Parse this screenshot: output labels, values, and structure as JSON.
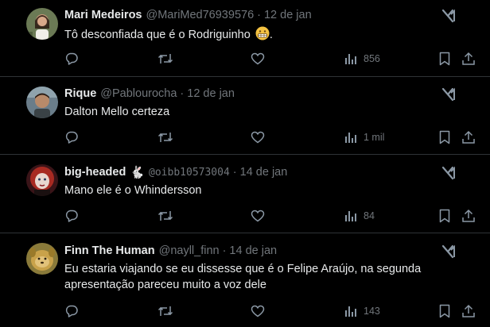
{
  "tweets": [
    {
      "name": "Mari Medeiros",
      "handle": "@MariMed76939576",
      "separator": "·",
      "date": "12 de jan",
      "text": "Tô desconfiada que é o Rodriguinho",
      "text_suffix": ".",
      "emoji": "grimacing-face-emoji",
      "views": "856"
    },
    {
      "name": "Rique",
      "handle": "@Pablourocha",
      "separator": "·",
      "date": "12 de jan",
      "text": "Dalton Mello certeza",
      "views": "1 mil"
    },
    {
      "name": "big-headed",
      "name_badge": "🐇",
      "handle": "@oibb10573004",
      "separator": "·",
      "date": "14 de jan",
      "text": "Mano ele é o Whindersson",
      "views": "84"
    },
    {
      "name": "Finn The Human",
      "handle": "@nayll_finn",
      "separator": "·",
      "date": "14 de jan",
      "text": "Eu estaria viajando se eu dissesse que é o Felipe Araújo, na segunda apresentação pareceu muito a voz dele",
      "views": "143"
    }
  ],
  "icons": {
    "reply": "reply-icon",
    "retweet": "retweet-icon",
    "like": "like-icon",
    "views": "views-icon",
    "bookmark": "bookmark-icon",
    "share": "share-icon",
    "grok": "grok-icon"
  },
  "colors": {
    "background": "#000000",
    "text": "#e7e9ea",
    "muted": "#71767b",
    "divider": "#2f3336"
  }
}
